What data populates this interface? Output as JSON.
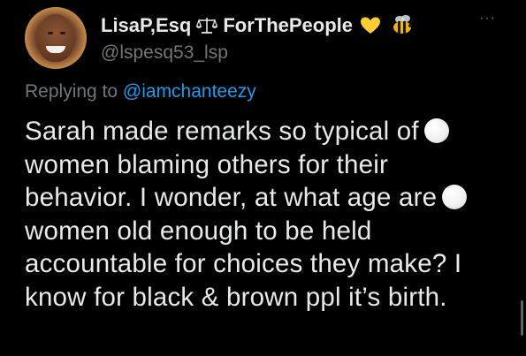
{
  "tweet": {
    "author": {
      "display_name": "LisaP,Esq",
      "display_name_suffix": "ForThePeople",
      "handle": "@lspesq53_lsp",
      "avatar_icon": "profile-photo",
      "badges": [
        "scales-icon",
        "yellow-heart-icon",
        "bee-icon"
      ]
    },
    "more_icon": "···",
    "replying": {
      "prefix": "Replying to",
      "mention": "@iamchanteezy"
    },
    "lines": [
      "Sarah made remarks so typical of",
      "women blaming others for their",
      "behavior. I wonder, at what age are",
      "women old enough to be held",
      "accountable for choices they make? I",
      "know for black & brown ppl it’s birth."
    ],
    "inline_icons": [
      "white-circle-icon",
      "white-circle-icon"
    ]
  },
  "colors": {
    "background": "#000000",
    "text_primary": "#e7e9ea",
    "text_secondary": "#71767b",
    "link": "#1d9bf0",
    "heart": "#ffcc33"
  }
}
